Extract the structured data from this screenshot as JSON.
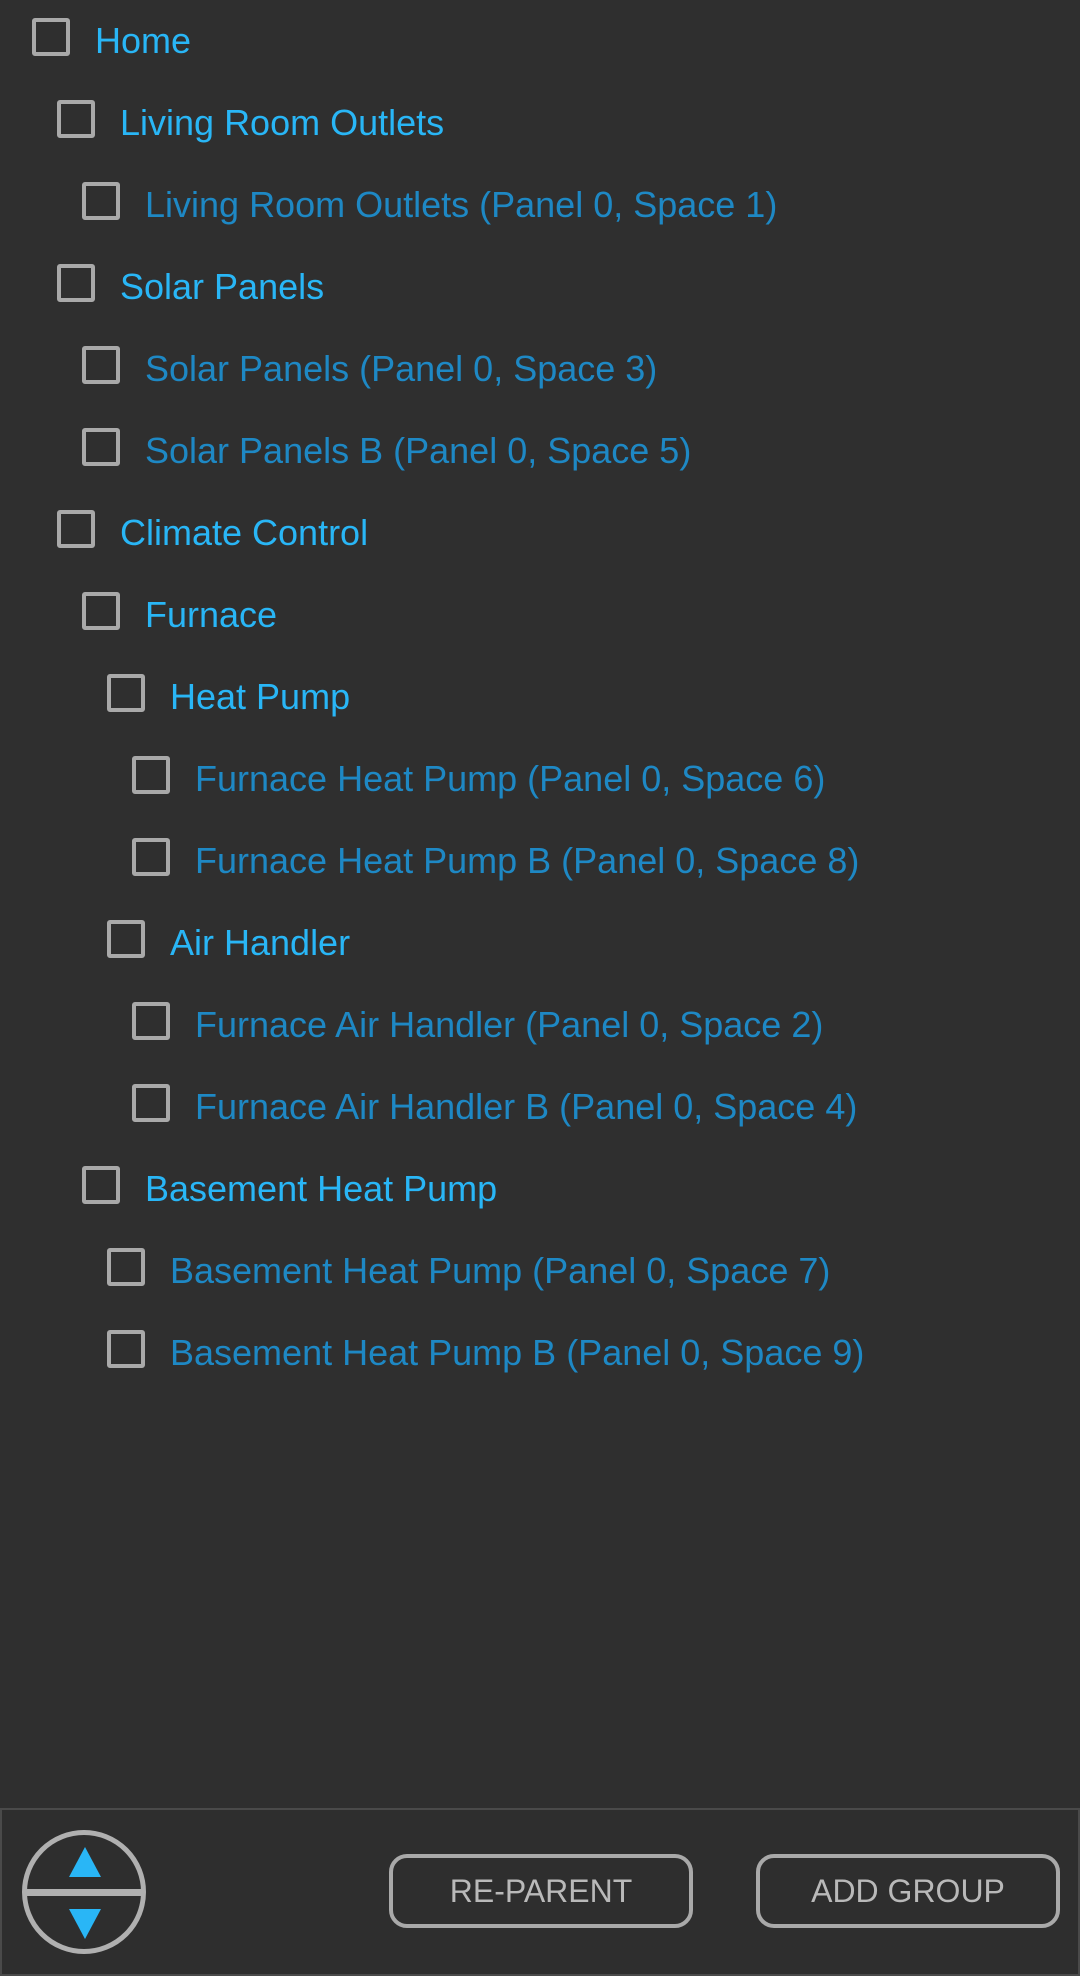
{
  "tree": {
    "items": [
      {
        "label": "Home",
        "kind": "group",
        "depth": 0
      },
      {
        "label": "Living Room Outlets",
        "kind": "group",
        "depth": 1
      },
      {
        "label": "Living Room Outlets (Panel 0, Space 1)",
        "kind": "circuit",
        "depth": 2
      },
      {
        "label": "Solar Panels",
        "kind": "group",
        "depth": 1
      },
      {
        "label": "Solar Panels (Panel 0, Space 3)",
        "kind": "circuit",
        "depth": 2
      },
      {
        "label": "Solar Panels B (Panel 0, Space 5)",
        "kind": "circuit",
        "depth": 2
      },
      {
        "label": "Climate Control",
        "kind": "group",
        "depth": 1
      },
      {
        "label": "Furnace",
        "kind": "group",
        "depth": 2
      },
      {
        "label": "Heat Pump",
        "kind": "group",
        "depth": 3
      },
      {
        "label": "Furnace Heat Pump (Panel 0, Space 6)",
        "kind": "circuit",
        "depth": 4
      },
      {
        "label": "Furnace Heat Pump B (Panel 0, Space 8)",
        "kind": "circuit",
        "depth": 4
      },
      {
        "label": "Air Handler",
        "kind": "group",
        "depth": 3
      },
      {
        "label": "Furnace Air Handler (Panel 0, Space 2)",
        "kind": "circuit",
        "depth": 4
      },
      {
        "label": "Furnace Air Handler B (Panel 0, Space 4)",
        "kind": "circuit",
        "depth": 4
      },
      {
        "label": "Basement Heat Pump",
        "kind": "group",
        "depth": 2
      },
      {
        "label": "Basement Heat Pump (Panel 0, Space 7)",
        "kind": "circuit",
        "depth": 3
      },
      {
        "label": "Basement Heat Pump B (Panel 0, Space 9)",
        "kind": "circuit",
        "depth": 3
      }
    ]
  },
  "toolbar": {
    "move_up_icon": "triangle-up-icon",
    "move_down_icon": "triangle-down-icon",
    "reparent_label": "RE-PARENT",
    "add_group_label": "ADD GROUP"
  },
  "colors": {
    "background": "#2f2f2f",
    "group_text": "#29b6f6",
    "circuit_text": "#1e88c4",
    "checkbox_border": "#a9a9a9",
    "button_text": "#b9b9b9"
  }
}
